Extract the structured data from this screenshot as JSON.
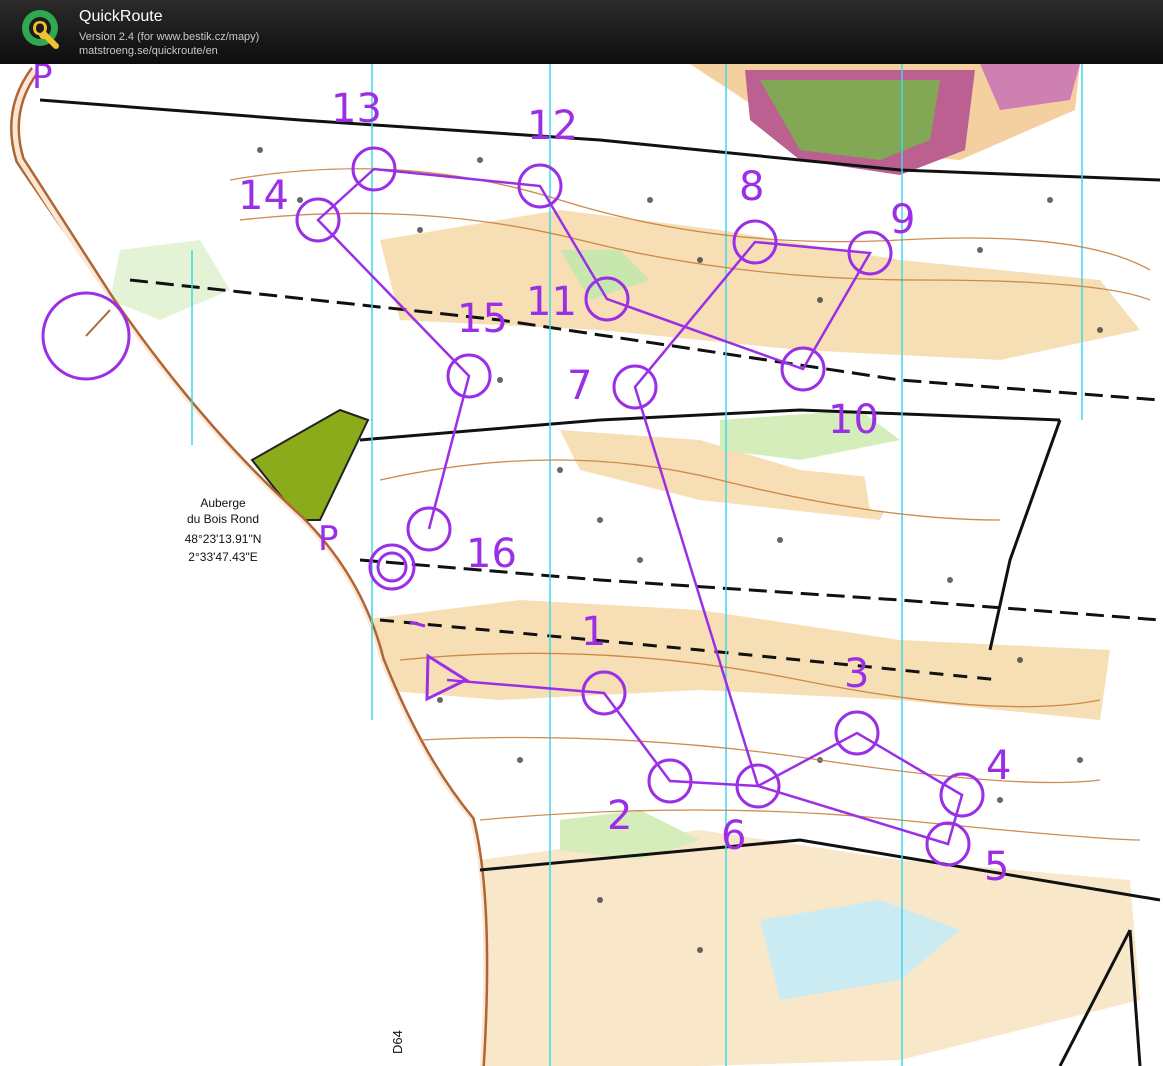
{
  "app": {
    "title": "QuickRoute",
    "version_line": "Version 2.4  (for www.bestik.cz/mapy)",
    "url_line": "matstroeng.se/quickroute/en",
    "logo_letter": "Q",
    "logo_icon": "quickroute-logo-icon"
  },
  "map": {
    "place_name": "Auberge",
    "place_name_2": "du Bois Rond",
    "lat": "48°23'13.91\"N",
    "lon": "2°33'47.43\"E",
    "road_label": "D64",
    "parking_label": "P",
    "course_color": "#9b2fe6",
    "controls": [
      "1",
      "2",
      "3",
      "4",
      "5",
      "6",
      "7",
      "8",
      "9",
      "10",
      "11",
      "12",
      "13",
      "14",
      "15",
      "16"
    ]
  }
}
